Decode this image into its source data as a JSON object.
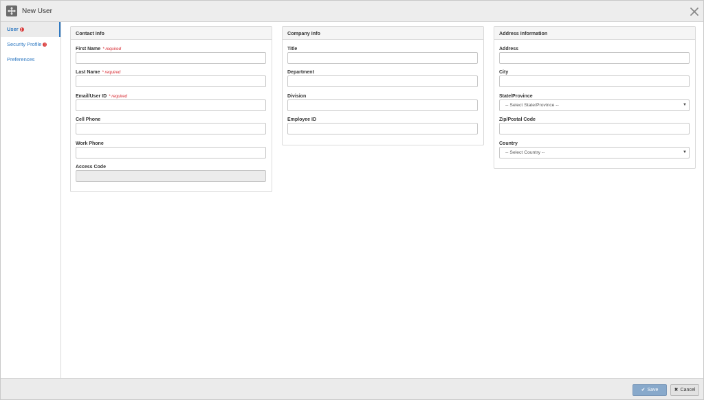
{
  "window": {
    "title": "New User",
    "close_glyph": "✕"
  },
  "sidebar": {
    "items": [
      {
        "label": "User",
        "alert": true,
        "active": true
      },
      {
        "label": "Security Profile",
        "alert": true,
        "active": false
      },
      {
        "label": "Preferences",
        "alert": false,
        "active": false
      }
    ]
  },
  "contact_info": {
    "heading": "Contact Info",
    "required_text": "* required",
    "fields": [
      {
        "label": "First Name",
        "required": true,
        "value": ""
      },
      {
        "label": "Last Name",
        "required": true,
        "value": ""
      },
      {
        "label": "Email/User ID",
        "required": true,
        "value": ""
      },
      {
        "label": "Cell Phone",
        "required": false,
        "value": ""
      },
      {
        "label": "Work Phone",
        "required": false,
        "value": ""
      },
      {
        "label": "Access Code",
        "required": false,
        "value": "",
        "disabled": true
      }
    ]
  },
  "company_info": {
    "heading": "Company Info",
    "fields": [
      {
        "label": "Title",
        "value": ""
      },
      {
        "label": "Department",
        "value": ""
      },
      {
        "label": "Division",
        "value": ""
      },
      {
        "label": "Employee ID",
        "value": ""
      }
    ]
  },
  "address_info": {
    "heading": "Address Information",
    "address_label": "Address",
    "city_label": "City",
    "state_label": "State/Province",
    "state_selected": "-- Select State/Province --",
    "zip_label": "Zip/Postal Code",
    "country_label": "Country",
    "country_selected": "-- Select Country --"
  },
  "footer": {
    "save_label": "Save",
    "cancel_label": "Cancel",
    "save_glyph": "✔",
    "cancel_glyph": "✖"
  },
  "icons": {
    "app": "move-arrows-icon",
    "close": "close-icon",
    "alert": "exclamation-circle-icon",
    "select": "caret-down-icon",
    "save": "check-icon",
    "cancel": "x-icon"
  },
  "colors": {
    "link": "#2f79c2",
    "required": "#d6252d",
    "save_button": "#88a9cb",
    "alert": "#d93b3b"
  }
}
